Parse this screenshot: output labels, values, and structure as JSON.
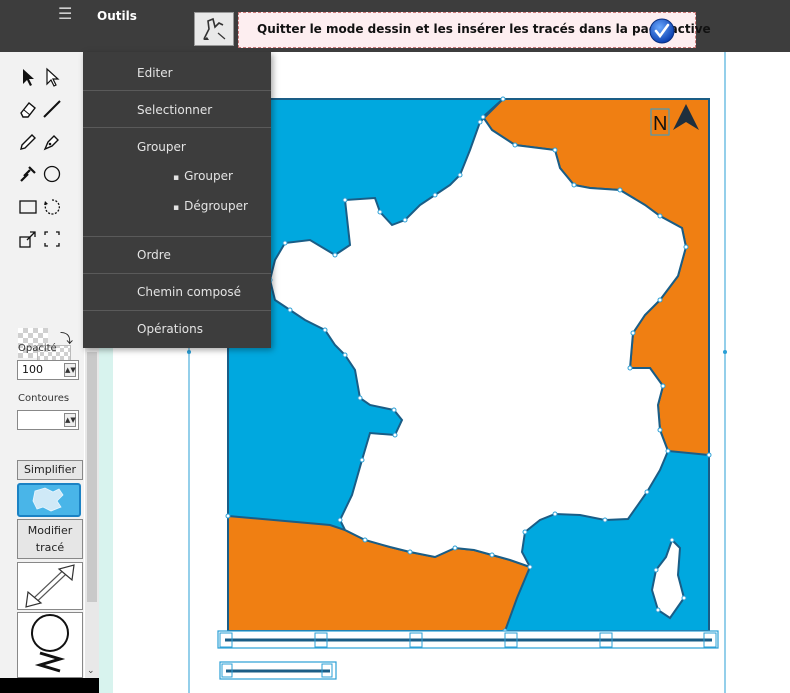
{
  "topbar": {
    "menu_label": "Outils",
    "hamburger_icon": "hamburger-icon",
    "draw_mode_icon": "draw-mode-icon",
    "quit_text": "Quitter le mode dessin et les insérer les tracés dans la page active",
    "check_icon": "check-circle-icon"
  },
  "dropdown": {
    "items": [
      {
        "label": "Editer"
      },
      {
        "label": "Selectionner"
      },
      {
        "label": "Grouper"
      },
      {
        "label": "Ordre"
      },
      {
        "label": "Chemin composé"
      },
      {
        "label": "Opérations"
      }
    ],
    "group_submenu": [
      {
        "label": "Grouper"
      },
      {
        "label": "Dégrouper"
      }
    ]
  },
  "toolbox": {
    "tools": [
      "select-arrow-icon",
      "direct-select-icon",
      "eraser-icon",
      "line-icon",
      "pencil-icon",
      "pen-icon",
      "eyedropper-icon",
      "ellipse-icon",
      "rectangle-icon",
      "lasso-icon",
      "resize-icon",
      "marquee-icon"
    ],
    "opacity_label": "Opacité",
    "opacity_value": "100",
    "contours_label": "Contoures",
    "contours_value": "",
    "simplify_label": "Simplifier",
    "modify_label_line1": "Modifier",
    "modify_label_line2": "tracé"
  },
  "map": {
    "north_label": "N",
    "colors": {
      "sea": "#00a8df",
      "neighbor": "#f07f12",
      "border": "#1a5d86",
      "node": "#2a9fd6"
    }
  },
  "colors": {
    "topbar": "#3d3d3d",
    "menu_text": "#e4e4e4",
    "banner_bg": "#fdeef0"
  }
}
